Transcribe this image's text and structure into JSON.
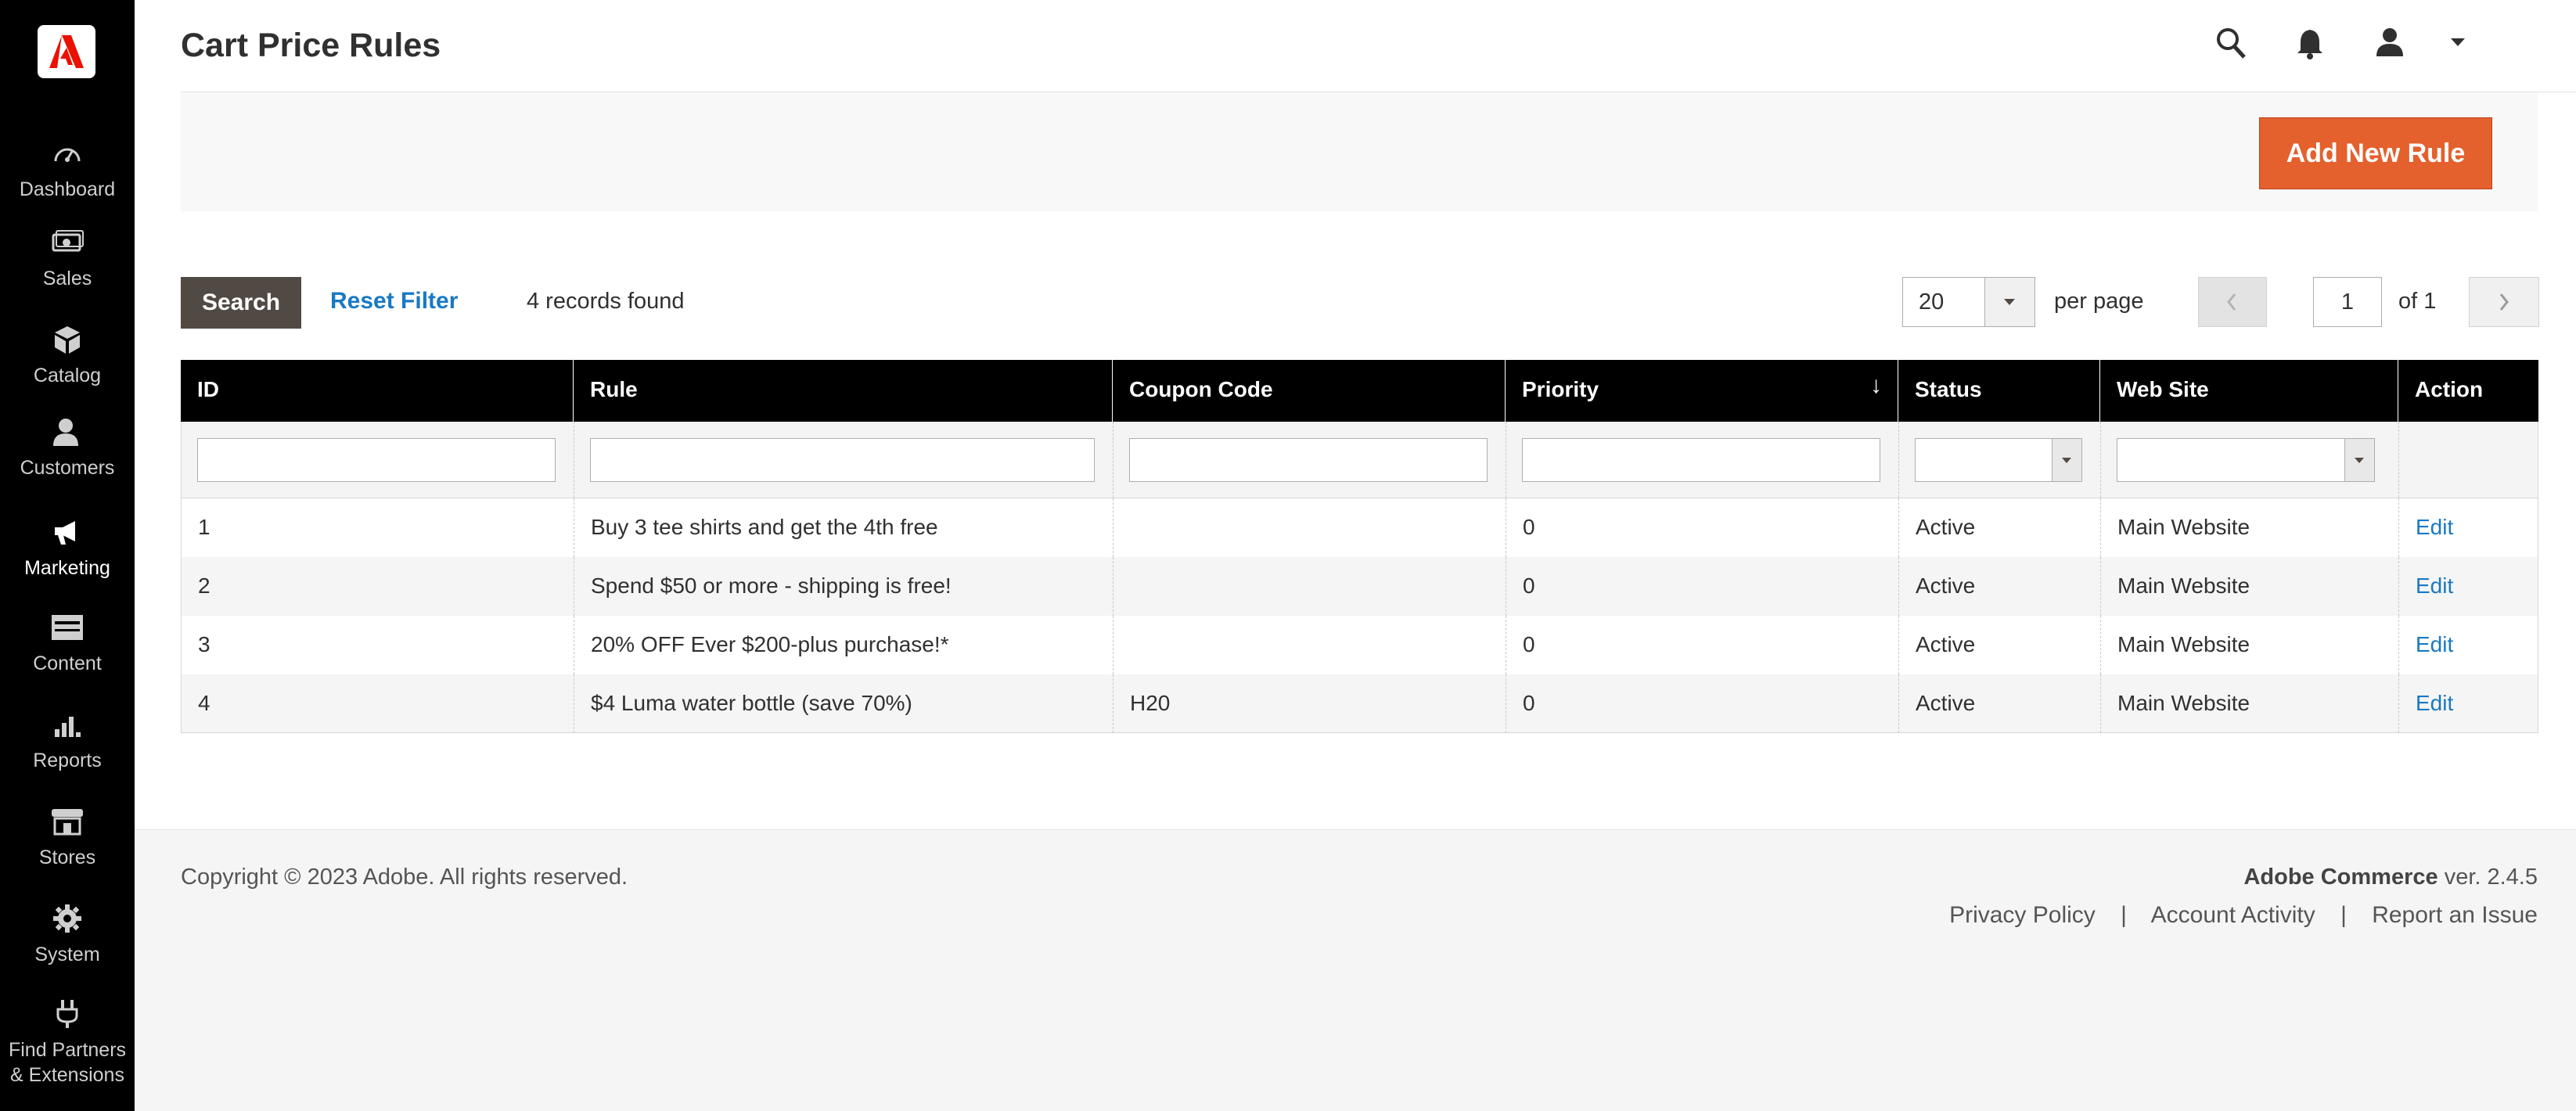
{
  "sidebar": {
    "logo": "adobe-logo",
    "items": [
      {
        "label": "Dashboard",
        "icon": "dashboard-icon"
      },
      {
        "label": "Sales",
        "icon": "sales-icon"
      },
      {
        "label": "Catalog",
        "icon": "catalog-icon"
      },
      {
        "label": "Customers",
        "icon": "customers-icon"
      },
      {
        "label": "Marketing",
        "icon": "marketing-icon"
      },
      {
        "label": "Content",
        "icon": "content-icon"
      },
      {
        "label": "Reports",
        "icon": "reports-icon"
      },
      {
        "label": "Stores",
        "icon": "stores-icon"
      },
      {
        "label": "System",
        "icon": "system-icon"
      },
      {
        "label": "Find Partners",
        "label2": "& Extensions",
        "icon": "extensions-icon"
      }
    ]
  },
  "header": {
    "title": "Cart Price Rules"
  },
  "actions": {
    "add_label": "Add New Rule"
  },
  "toolbar": {
    "search_label": "Search",
    "reset_label": "Reset Filter",
    "records_text": "4 records found",
    "per_page_value": "20",
    "per_page_label": "per page",
    "page_value": "1",
    "page_of": "of 1"
  },
  "grid": {
    "columns": [
      "ID",
      "Rule",
      "Coupon Code",
      "Priority",
      "Status",
      "Web Site",
      "Action"
    ],
    "sort_indicator": "↓",
    "rows": [
      {
        "id": "1",
        "rule": "Buy 3 tee shirts and get the 4th free",
        "coupon": "",
        "priority": "0",
        "status": "Active",
        "website": "Main Website",
        "action": "Edit"
      },
      {
        "id": "2",
        "rule": "Spend $50 or more - shipping is free!",
        "coupon": "",
        "priority": "0",
        "status": "Active",
        "website": "Main Website",
        "action": "Edit"
      },
      {
        "id": "3",
        "rule": "20% OFF Ever $200-plus purchase!*",
        "coupon": "",
        "priority": "0",
        "status": "Active",
        "website": "Main Website",
        "action": "Edit"
      },
      {
        "id": "4",
        "rule": "$4 Luma water bottle (save 70%)",
        "coupon": "H20",
        "priority": "0",
        "status": "Active",
        "website": "Main Website",
        "action": "Edit"
      }
    ]
  },
  "footer": {
    "copyright": "Copyright © 2023 Adobe. All rights reserved.",
    "product": "Adobe Commerce",
    "version": " ver. 2.4.5",
    "links": [
      "Privacy Policy",
      "Account Activity",
      "Report an Issue"
    ],
    "separator": "|"
  },
  "colors": {
    "accent": "#e4602d",
    "link": "#1979c3",
    "sidebar_bg": "#000000",
    "search_btn": "#514943"
  }
}
